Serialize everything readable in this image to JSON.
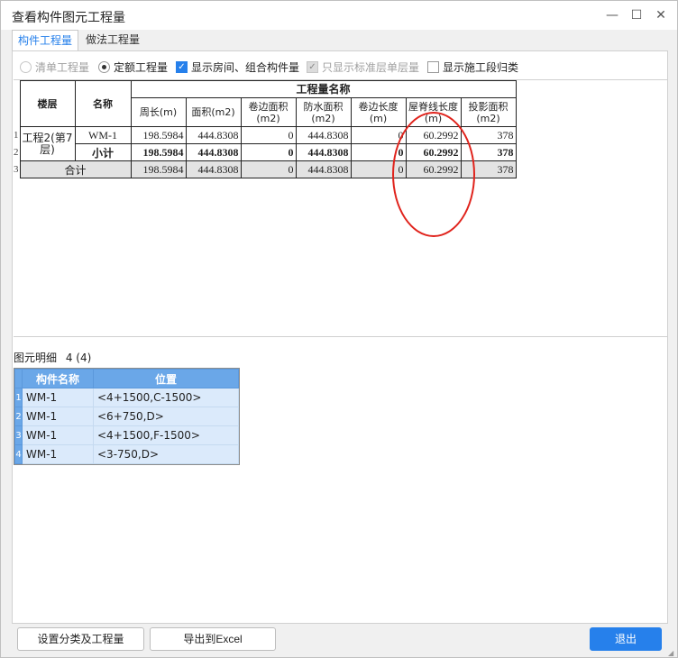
{
  "window": {
    "title": "查看构件图元工程量",
    "minimize": "—",
    "maximize": "☐",
    "close": "✕"
  },
  "tabs": [
    {
      "label": "构件工程量",
      "active": true
    },
    {
      "label": "做法工程量",
      "active": false
    }
  ],
  "options": {
    "bill_quantity": {
      "label": "清单工程量",
      "checked": false,
      "disabled": true
    },
    "quota_quantity": {
      "label": "定额工程量",
      "checked": true,
      "disabled": false
    },
    "show_rooms": {
      "label": "显示房间、组合构件量",
      "checked": true,
      "disabled": false
    },
    "standard_floor_only": {
      "label": "只显示标准层单层量",
      "checked": true,
      "disabled": true
    },
    "show_sections": {
      "label": "显示施工段归类",
      "checked": false,
      "disabled": false
    }
  },
  "quantity_table": {
    "col_floor": "楼层",
    "col_name": "名称",
    "group_header": "工程量名称",
    "columns": [
      "周长(m)",
      "面积(m2)",
      "卷边面积(m2)",
      "防水面积(m2)",
      "卷边长度(m)",
      "屋脊线长度(m)",
      "投影面积(m2)"
    ],
    "rows": [
      {
        "no": "1",
        "floor": "工程2(第7层)",
        "name": "WM-1",
        "values": [
          "198.5984",
          "444.8308",
          "0",
          "444.8308",
          "0",
          "60.2992",
          "378"
        ]
      },
      {
        "no": "2",
        "name": "小计",
        "values": [
          "198.5984",
          "444.8308",
          "0",
          "444.8308",
          "0",
          "60.2992",
          "378"
        ]
      },
      {
        "no": "3",
        "name": "合计",
        "values": [
          "198.5984",
          "444.8308",
          "0",
          "444.8308",
          "0",
          "60.2992",
          "378"
        ]
      }
    ]
  },
  "detail": {
    "title": "图元明细",
    "count": "4 (4)",
    "col_name": "构件名称",
    "col_position": "位置",
    "rows": [
      {
        "no": "1",
        "name": "WM-1",
        "position": "<4+1500,C-1500>"
      },
      {
        "no": "2",
        "name": "WM-1",
        "position": "<6+750,D>"
      },
      {
        "no": "3",
        "name": "WM-1",
        "position": "<4+1500,F-1500>"
      },
      {
        "no": "4",
        "name": "WM-1",
        "position": "<3-750,D>"
      }
    ]
  },
  "footer": {
    "settings_button": "设置分类及工程量",
    "export_button": "导出到Excel",
    "exit_button": "退出"
  },
  "colors": {
    "accent": "#2680eb",
    "highlight_circle": "#e0231c",
    "detail_header": "#6aa7e8",
    "detail_row": "#dbeafb"
  }
}
